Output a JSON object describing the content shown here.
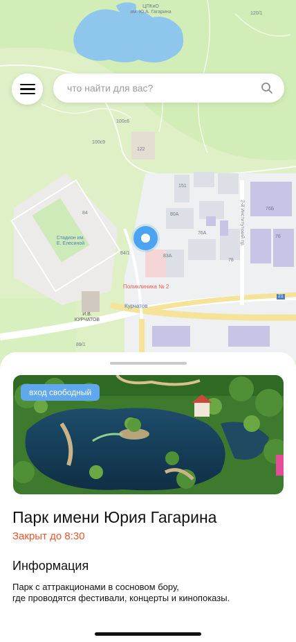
{
  "map": {
    "labels": {
      "top_landmark": "ЦПКиО\nим. Ю.А. Гагарина",
      "stadium": "Стадион им.\nЕ. Елесиной",
      "monument": "И.В.\nКУРЧАТОВ",
      "clinic": "Поликлиника № 2",
      "metro": "Курчатов",
      "street": "2-й Институтский пр.",
      "n120": "120/1",
      "n100": "100с6",
      "n100c9": "100с9",
      "n122": "122",
      "n151": "151",
      "n84": "84",
      "n80a": "80А",
      "n84_1": "84/1",
      "n83a": "83А",
      "n76a": "76А",
      "n78": "78",
      "n76": "76",
      "n76b": "76Б",
      "n89": "89/1",
      "n21": "21"
    }
  },
  "header": {
    "menu_icon": "hamburger-icon",
    "search": {
      "placeholder": "что найти для вас?",
      "icon": "search-icon"
    }
  },
  "place": {
    "badge": "вход свободный",
    "title": "Парк имени Юрия Гагарина",
    "status": "Закрыт до 8:30",
    "info_heading": "Информация",
    "info_text": "Парк с аттракционами в сосновом бору,\nгде проводятся фестивали, концерты и кинопоказы."
  },
  "colors": {
    "accent": "#5fa8ee",
    "status_closed": "#e8572f",
    "pin": "#4ca3f0"
  }
}
